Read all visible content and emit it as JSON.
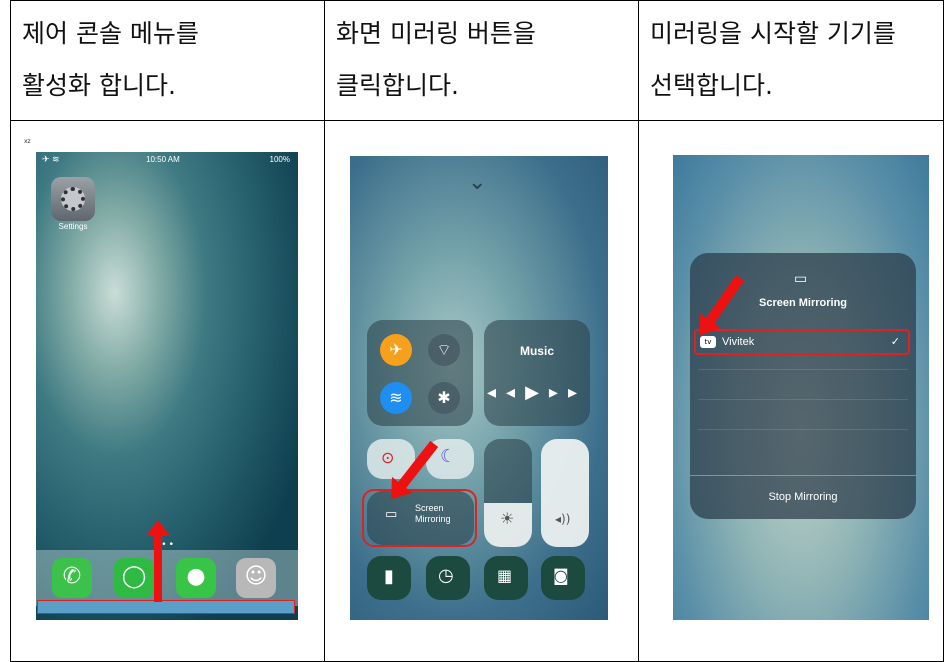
{
  "headers": [
    {
      "line1": "제어 콘솔 메뉴를",
      "line2": "활성화 합니다."
    },
    {
      "line1": "화면 미러링 버튼을",
      "line2": "클릭합니다."
    },
    {
      "line1": "미러링을 시작할 기기를",
      "line2": "선택합니다."
    }
  ],
  "phone1": {
    "mark": "xz",
    "time": "10:50 AM",
    "battery": "100%",
    "settings_label": "Settings"
  },
  "phone2": {
    "music_label": "Music",
    "screen_mirroring_line1": "Screen",
    "screen_mirroring_line2": "Mirroring"
  },
  "phone3": {
    "title": "Screen Mirroring",
    "device_badge": "tv",
    "device_name": "Vivitek",
    "stop_label": "Stop Mirroring"
  },
  "colors": {
    "highlight": "#dd2222",
    "arrow": "#ee1111",
    "orange": "#f7a01b",
    "blue": "#1f8ef1"
  }
}
